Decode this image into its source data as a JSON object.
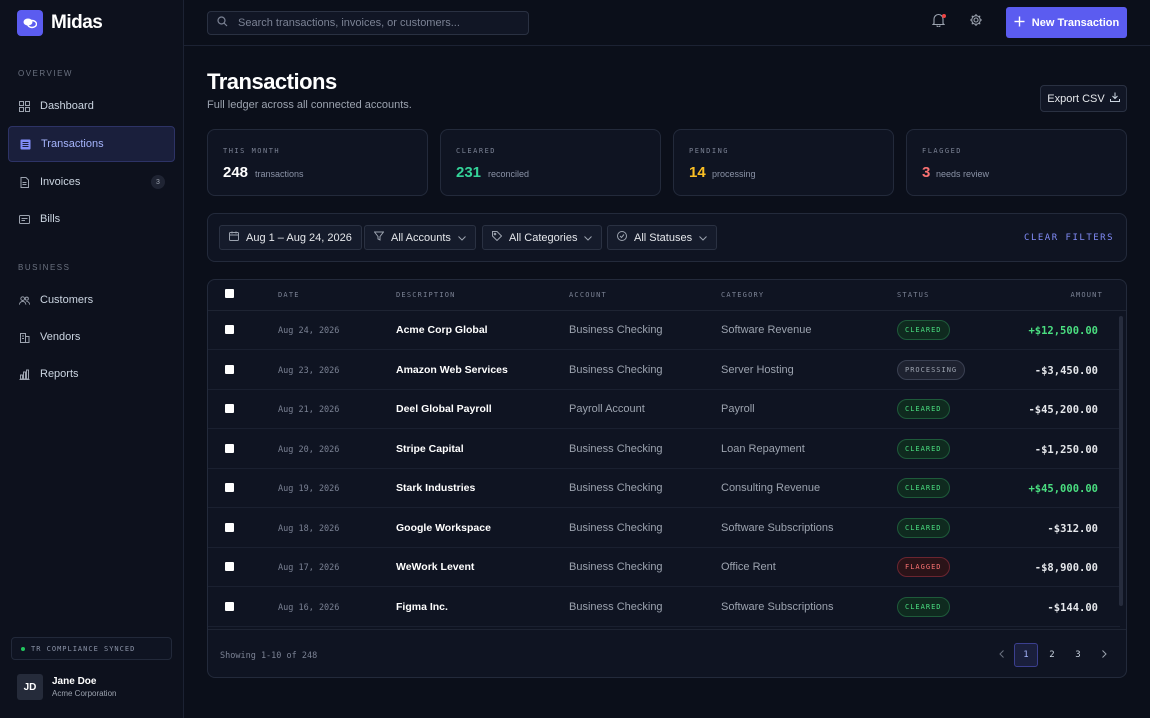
{
  "brand": {
    "name": "Midas"
  },
  "sidebar": {
    "sections": [
      {
        "label": "OVERVIEW",
        "items": [
          {
            "label": "Dashboard",
            "icon": "grid-icon"
          },
          {
            "label": "Transactions",
            "icon": "list-icon",
            "active": true
          },
          {
            "label": "Invoices",
            "icon": "document-icon",
            "badge": "3"
          },
          {
            "label": "Bills",
            "icon": "receipt-icon"
          }
        ]
      },
      {
        "label": "BUSINESS",
        "items": [
          {
            "label": "Customers",
            "icon": "users-icon"
          },
          {
            "label": "Vendors",
            "icon": "building-icon"
          },
          {
            "label": "Reports",
            "icon": "bar-chart-icon"
          }
        ]
      }
    ],
    "sync_status": "TR COMPLIANCE SYNCED",
    "user": {
      "initials": "JD",
      "name": "Jane Doe",
      "org": "Acme Corporation"
    }
  },
  "header": {
    "search_placeholder": "Search transactions, invoices, or customers...",
    "new_button": "New Transaction"
  },
  "page": {
    "title": "Transactions",
    "subtitle": "Full ledger across all connected accounts.",
    "export_label": "Export CSV"
  },
  "stats": [
    {
      "label": "THIS MONTH",
      "value": "248",
      "desc": "transactions",
      "color": "#ffffff"
    },
    {
      "label": "CLEARED",
      "value": "231",
      "desc": "reconciled",
      "color": "#34d399"
    },
    {
      "label": "PENDING",
      "value": "14",
      "desc": "processing",
      "color": "#fbbf24"
    },
    {
      "label": "FLAGGED",
      "value": "3",
      "desc": "needs review",
      "color": "#f87171"
    }
  ],
  "filters": {
    "date": "Aug 1 – Aug 24, 2026",
    "accounts": "All Accounts",
    "categories": "All Categories",
    "statuses": "All Statuses",
    "clear": "CLEAR FILTERS"
  },
  "table": {
    "columns": {
      "date": "DATE",
      "description": "DESCRIPTION",
      "account": "ACCOUNT",
      "category": "CATEGORY",
      "status": "STATUS",
      "amount": "AMOUNT"
    },
    "rows": [
      {
        "date": "Aug 24, 2026",
        "description": "Acme Corp Global",
        "account": "Business Checking",
        "category": "Software Revenue",
        "status": "CLEARED",
        "amount": "+$12,500.00",
        "positive": true
      },
      {
        "date": "Aug 23, 2026",
        "description": "Amazon Web Services",
        "account": "Business Checking",
        "category": "Server Hosting",
        "status": "PROCESSING",
        "amount": "-$3,450.00",
        "positive": false
      },
      {
        "date": "Aug 21, 2026",
        "description": "Deel Global Payroll",
        "account": "Payroll Account",
        "category": "Payroll",
        "status": "CLEARED",
        "amount": "-$45,200.00",
        "positive": false
      },
      {
        "date": "Aug 20, 2026",
        "description": "Stripe Capital",
        "account": "Business Checking",
        "category": "Loan Repayment",
        "status": "CLEARED",
        "amount": "-$1,250.00",
        "positive": false
      },
      {
        "date": "Aug 19, 2026",
        "description": "Stark Industries",
        "account": "Business Checking",
        "category": "Consulting Revenue",
        "status": "CLEARED",
        "amount": "+$45,000.00",
        "positive": true
      },
      {
        "date": "Aug 18, 2026",
        "description": "Google Workspace",
        "account": "Business Checking",
        "category": "Software Subscriptions",
        "status": "CLEARED",
        "amount": "-$312.00",
        "positive": false
      },
      {
        "date": "Aug 17, 2026",
        "description": "WeWork Levent",
        "account": "Business Checking",
        "category": "Office Rent",
        "status": "FLAGGED",
        "amount": "-$8,900.00",
        "positive": false
      },
      {
        "date": "Aug 16, 2026",
        "description": "Figma Inc.",
        "account": "Business Checking",
        "category": "Software Subscriptions",
        "status": "CLEARED",
        "amount": "-$144.00",
        "positive": false
      }
    ],
    "showing": "Showing 1-10 of 248",
    "pages": [
      "1",
      "2",
      "3"
    ],
    "current_page": "1"
  },
  "colors": {
    "accent": "#5b5cf0",
    "positive": "#4ade80",
    "negative": "#e5e7eb"
  }
}
